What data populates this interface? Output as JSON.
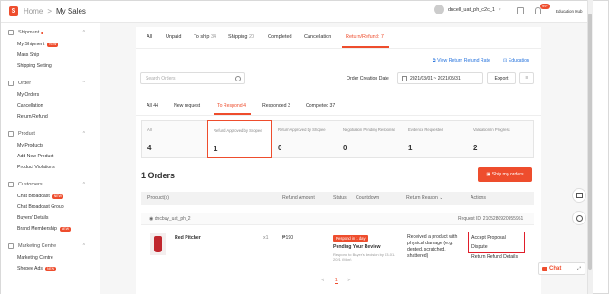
{
  "topbar": {
    "logo_glyph": "S",
    "breadcrumb": {
      "home": "Home",
      "separator": ">",
      "current": "My Sales"
    },
    "username": "dncell_uat_ph_c2c_1",
    "notification_badge": "99+",
    "education_hub": "Education Hub"
  },
  "sidebar": {
    "groups": [
      {
        "title": "Shipment",
        "items": [
          "My Shipment",
          "Mass Ship",
          "Shipping Setting"
        ]
      },
      {
        "title": "Order",
        "items": [
          "My Orders",
          "Cancellation",
          "Return/Refund"
        ]
      },
      {
        "title": "Product",
        "items": [
          "My Products",
          "Add New Product",
          "Product Violations"
        ]
      },
      {
        "title": "Customers",
        "items": [
          "Chat Broadcast",
          "Chat Broadcast Group",
          "Buyers' Details",
          "Brand Membership"
        ]
      },
      {
        "title": "Marketing Centre",
        "items": [
          "Marketing Centre",
          "Shopee Ads"
        ]
      }
    ],
    "new_tag": "NEW"
  },
  "status_tabs": [
    "All",
    "Unpaid",
    "To ship",
    "Shipping",
    "Completed",
    "Cancellation",
    "Return/Refund"
  ],
  "status_counts": {
    "To ship": "34",
    "Shipping": "20",
    "Return/Refund": "7"
  },
  "links": {
    "view_return_refund_rate": "View Return Refund Rate",
    "education": "Education"
  },
  "search": {
    "placeholder": "Search Orders"
  },
  "date_filter": {
    "label": "Order Creation Date",
    "value": "2021/03/01 ~ 2021/05/31"
  },
  "export_label": "Export",
  "sub_tabs": [
    "All 44",
    "New request",
    "To Respond 4",
    "Responded 3",
    "Completed 37"
  ],
  "stats": [
    {
      "label": "All",
      "value": "4"
    },
    {
      "label": "Refund Approved by Shopee",
      "value": "1"
    },
    {
      "label": "Return Approved by Shopee",
      "value": "0"
    },
    {
      "label": "Negotiation Pending Response",
      "value": "0"
    },
    {
      "label": "Evidence Requested",
      "value": "1"
    },
    {
      "label": "Validation In Progress",
      "value": "2"
    }
  ],
  "orders_title": "1 Orders",
  "ship_my_orders": "Ship my orders",
  "table_headers": [
    "Product(s)",
    "Refund Amount",
    "Status",
    "Countdown",
    "Return Reason",
    "Actions"
  ],
  "order": {
    "buyer": "dncbuy_uat_ph_2",
    "request_id": "Request ID: 2105280920955951",
    "product_name": "Red Pitcher",
    "quantity": "x1",
    "amount": "₱190",
    "status_tag": "Respond in 1 day",
    "status": "Pending Your Review",
    "status_note": "Respond to Buyer's decision by 03-01-2021 (Mon)",
    "reason_line1": "Received a product with",
    "reason_line2": "physical damage (e.g.",
    "reason_line3": "dented, scratched,",
    "reason_line4": "shattered)",
    "actions": [
      "Accept Proposal",
      "Dispute",
      "Return Refund Details"
    ]
  },
  "pager": {
    "prev": "<",
    "current": "1",
    "next": ">"
  },
  "chat_label": "Chat",
  "colors": {
    "accent": "#ee4d2d",
    "link": "#2673dd",
    "highlight_box": "#e01e2a"
  }
}
